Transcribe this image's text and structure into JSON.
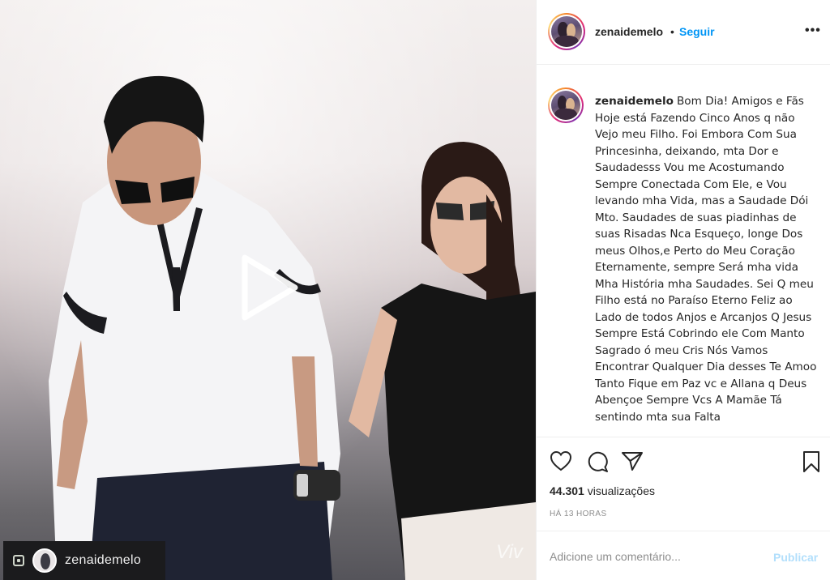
{
  "header": {
    "username": "zenaidemelo",
    "separator": "•",
    "follow_label": "Seguir",
    "more_label": "•••"
  },
  "caption": {
    "username": "zenaidemelo",
    "text": "Bom Dia! Amigos e Fãs Hoje está Fazendo Cinco Anos q não Vejo meu Filho. Foi Embora Com Sua Princesinha, deixando, mta Dor e Saudadesss Vou me Acostumando Sempre Conectada Com Ele, e Vou levando mha Vida, mas a Saudade Dói Mto. Saudades de suas piadinhas de suas Risadas Nca Esqueço, longe Dos meus Olhos,e Perto do Meu Coração Eternamente, sempre Será mha vida Mha História mha Saudades. Sei Q meu Filho está no Paraíso Eterno Feliz ao Lado de todos Anjos e Arcanjos Q Jesus Sempre Está Cobrindo ele Com Manto Sagrado ó meu Cris Nós Vamos Encontrar Qualquer Dia desses Te Amoo Tanto Fique em Paz vc e Allana q Deus Abençoe Sempre Vcs A Mamãe Tá sentindo mta sua Falta"
  },
  "video": {
    "owner_username": "zenaidemelo",
    "watermark": "Viv"
  },
  "actions": {
    "views_count": "44.301",
    "views_label": "visualizações",
    "timestamp": "HÁ 13 HORAS"
  },
  "comment": {
    "placeholder": "Adicione um comentário...",
    "publish_label": "Publicar"
  },
  "colors": {
    "link_blue": "#0095f6",
    "publish_disabled": "#b2dffc",
    "muted_text": "#8e8e8e",
    "border": "#efefef"
  },
  "icons": [
    "heart-icon",
    "comment-icon",
    "share-icon",
    "bookmark-icon",
    "play-icon",
    "reel-icon",
    "more-options-icon"
  ]
}
